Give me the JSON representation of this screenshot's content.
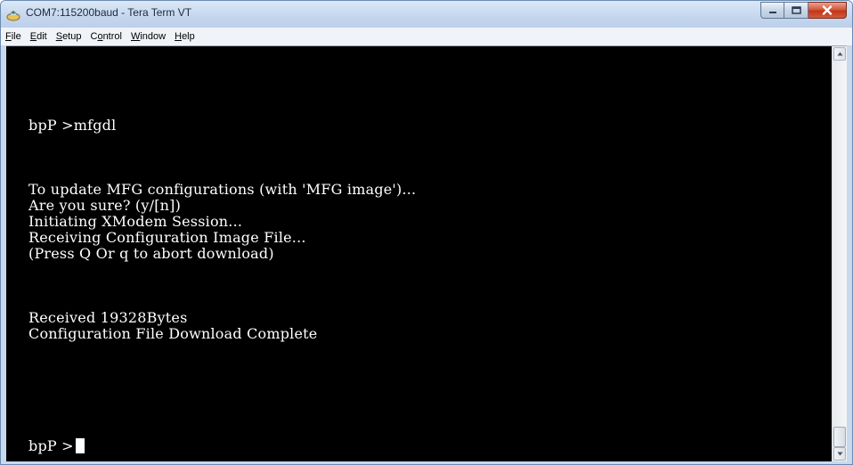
{
  "window": {
    "title": "COM7:115200baud - Tera Term VT"
  },
  "menu": [
    {
      "pre": "",
      "key": "F",
      "post": "ile"
    },
    {
      "pre": "",
      "key": "E",
      "post": "dit"
    },
    {
      "pre": "",
      "key": "S",
      "post": "etup"
    },
    {
      "pre": "C",
      "key": "o",
      "post": "ntrol"
    },
    {
      "pre": "",
      "key": "W",
      "post": "indow"
    },
    {
      "pre": "",
      "key": "H",
      "post": "elp"
    }
  ],
  "terminal": {
    "lines": [
      "bpP >mfgdl",
      "To update MFG configurations (with 'MFG image')...",
      "Are you sure? (y/[n])",
      "Initiating XModem Session...",
      "Receiving Configuration Image File...",
      "(Press Q Or q to abort download)",
      "Received 19328Bytes",
      "Configuration File Download Complete",
      "bpP >"
    ]
  },
  "colors": {
    "terminal_bg": "#000000",
    "terminal_fg": "#ffffff",
    "close_button": "#c7431f"
  }
}
